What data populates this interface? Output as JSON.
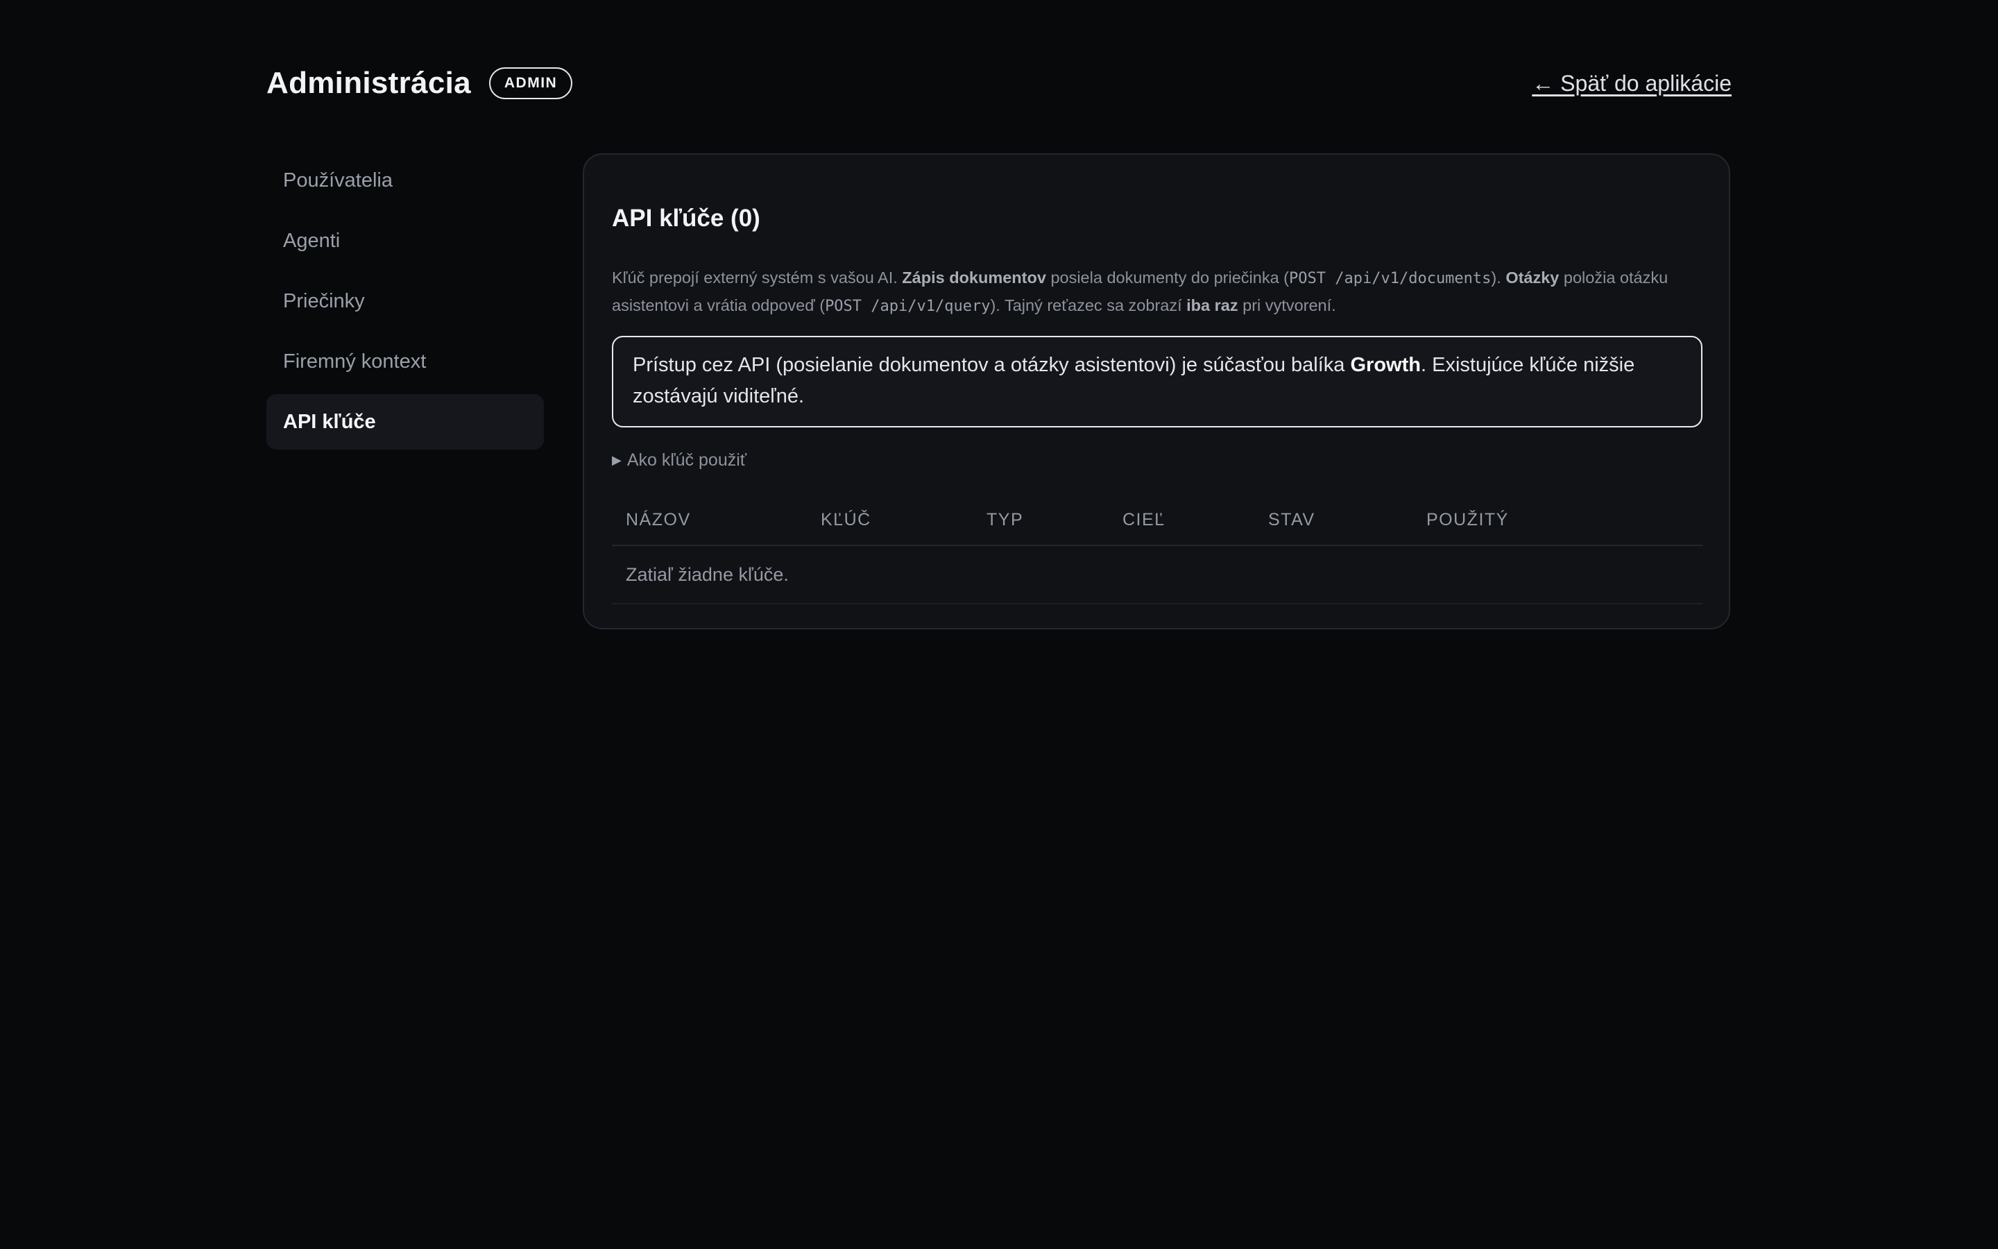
{
  "header": {
    "title": "Administrácia",
    "badge": "ADMIN",
    "back_link": "← Späť do aplikácie"
  },
  "sidebar": {
    "items": [
      {
        "label": "Používatelia",
        "active": false
      },
      {
        "label": "Agenti",
        "active": false
      },
      {
        "label": "Priečinky",
        "active": false
      },
      {
        "label": "Firemný kontext",
        "active": false
      },
      {
        "label": "API kľúče",
        "active": true
      }
    ]
  },
  "panel": {
    "title": "API kľúče (0)",
    "description": {
      "t1": "Kľúč prepojí externý systém s vašou AI. ",
      "b1": "Zápis dokumentov",
      "t2": " posiela dokumenty do priečinka (",
      "c1": "POST /api/v1/documents",
      "t3": "). ",
      "b2": "Otázky",
      "t4": " položia otázku asistentovi a vrátia odpoveď (",
      "c2": "POST /api/v1/query",
      "t5": "). Tajný reťazec sa zobrazí ",
      "b3": "iba raz",
      "t6": " pri vytvorení."
    },
    "notice": {
      "t1": "Prístup cez API (posielanie dokumentov a otázky asistentovi) je súčasťou balíka ",
      "b1": "Growth",
      "t2": ". Existujúce kľúče nižšie zostávajú viditeľné."
    },
    "howto": "Ako kľúč použiť",
    "howto_icon": "triangle-right-icon",
    "table": {
      "columns": [
        "NÁZOV",
        "KĽÚČ",
        "TYP",
        "CIEĽ",
        "STAV",
        "POUŽITÝ"
      ],
      "empty_text": "Zatiaľ žiadne kľúče."
    }
  }
}
